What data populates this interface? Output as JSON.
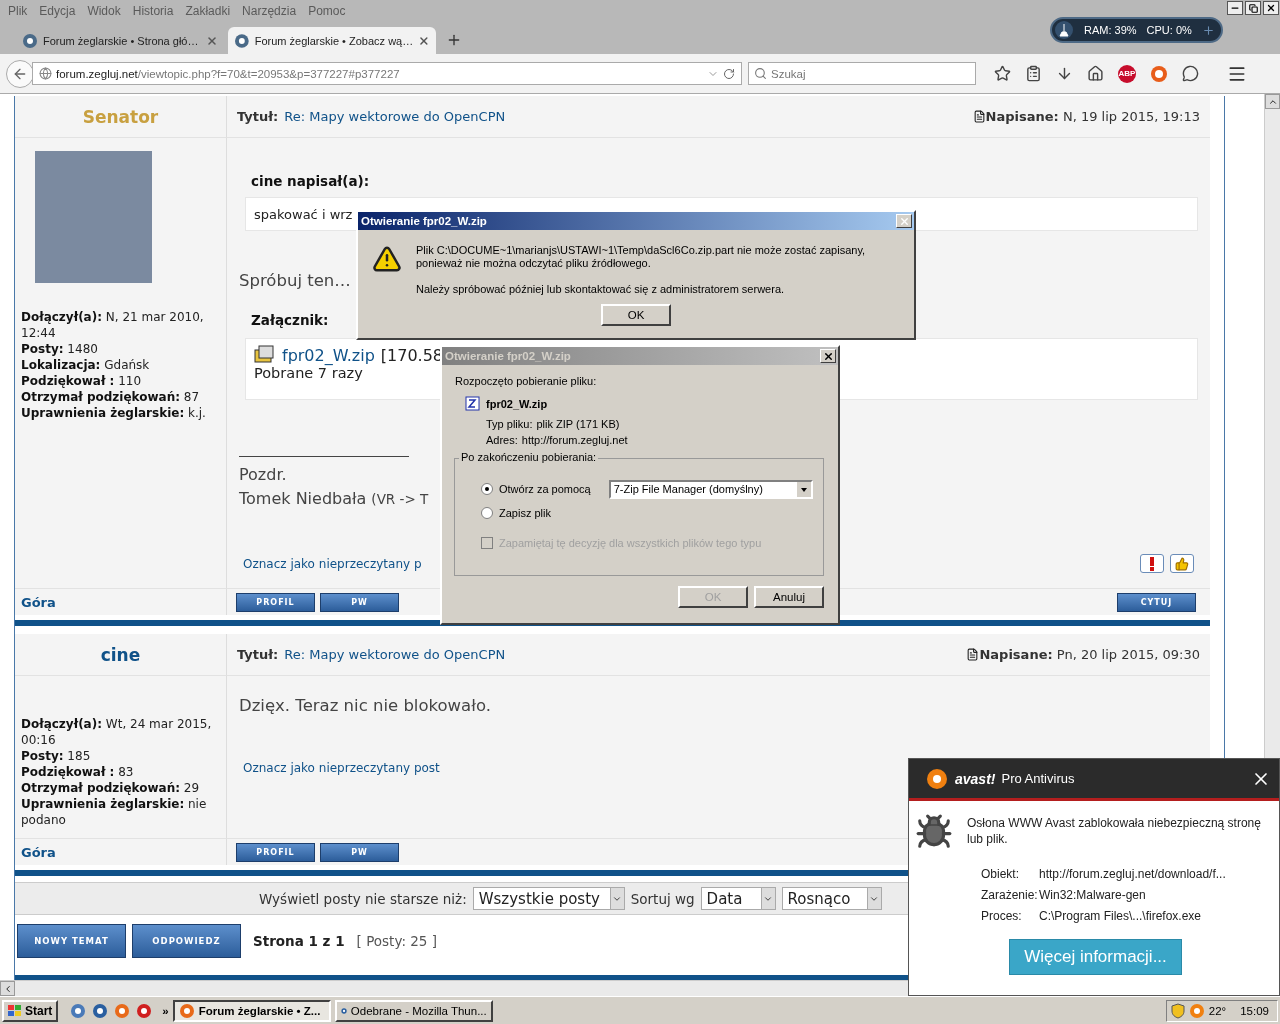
{
  "menu": [
    "Plik",
    "Edycja",
    "Widok",
    "Historia",
    "Zakładki",
    "Narzędzia",
    "Pomoc"
  ],
  "tabs": [
    {
      "label": "Forum żeglarskie • Strona głó…",
      "selected": false
    },
    {
      "label": "Forum żeglarskie • Zobacz wą…",
      "selected": true
    }
  ],
  "monitor": {
    "ram": "RAM: 39%",
    "cpu": "CPU: 0%"
  },
  "address": {
    "host": "forum.zegluj.net",
    "path": "/viewtopic.php?f=70&t=20953&p=377227#p377227"
  },
  "search": {
    "placeholder": "Szukaj"
  },
  "abp_badge": "ABP",
  "posts": [
    {
      "author": "Senator",
      "color": "#c8a040",
      "avatar": true,
      "title_label": "Tytuł:",
      "title": "Re: Mapy wektorowe do OpenCPN",
      "posted": "**Napisane:** N, 19 lip 2015, 19:13",
      "profile": [
        "**Dołączył(a):** N, 21 mar 2010, 12:44",
        "**Posty:** 1480",
        "**Lokalizacja:** Gdańsk",
        "**Podziękował :** 110",
        "**Otrzymał podziękowań:** 87",
        "**Uprawnienia żeglarskie:** k.j."
      ],
      "quote_author": "cine napisał(a):",
      "quote": "spakować i wrz",
      "text": "Spróbuj ten…",
      "attachment_label": "Załącznik:",
      "attachment": {
        "name": "fpr02_W.zip",
        "size": "[170.58",
        "downloads": "Pobrane 7 razy"
      },
      "signature": {
        "greeting": "Pozdr.",
        "name": "Tomek Niedbała",
        "note": "(VR -> T"
      },
      "mark_unread": "Oznacz jako nieprzeczytany p",
      "report_icons": true,
      "top": "Góra",
      "buttons": [
        "PROFIL",
        "PW"
      ],
      "quote_button": "CYTUJ"
    },
    {
      "author": "cine",
      "color": "#105289",
      "title_label": "Tytuł:",
      "title": "Re: Mapy wektorowe do OpenCPN",
      "posted": "**Napisane:** Pn, 20 lip 2015, 09:30",
      "profile": [
        "**Dołączył(a):** Wt, 24 mar 2015, 00:16",
        "**Posty:** 185",
        "**Podziękował :** 83",
        "**Otrzymał podziękowań:** 29",
        "**Uprawnienia żeglarskie:** nie podano"
      ],
      "text": "Dzięx. Teraz nic nie blokowało.",
      "mark_unread": "Oznacz jako nieprzeczytany post",
      "top": "Góra",
      "buttons": [
        "PROFIL",
        "PW"
      ]
    }
  ],
  "sort_bar": {
    "label": "Wyświetl posty nie starsze niż:",
    "range": "Wszystkie posty",
    "sort_label": "Sortuj wg",
    "sort_key": "Data",
    "order": "Rosnąco"
  },
  "actions": {
    "buttons": [
      "NOWY TEMAT",
      "ODPOWIEDZ"
    ],
    "page": "Strona 1 z 1",
    "count": "[ Posty: 25 ]"
  },
  "dialogs": [
    {
      "kind": "error",
      "active": true,
      "title": "Otwieranie fpr02_W.zip",
      "message": "Plik C:\\DOCUME~1\\marianjs\\USTAWI~1\\Temp\\daScl6Co.zip.part nie może zostać zapisany, ponieważ nie można odczytać pliku źródłowego.",
      "hint": "Należy spróbować później lub skontaktować się z administratorem serwera.",
      "ok": "OK"
    },
    {
      "kind": "download",
      "active": false,
      "title": "Otwieranie fpr02_W.zip",
      "heading": "Rozpoczęto pobieranie pliku:",
      "file": "fpr02_W.zip",
      "type_label": "Typ pliku:",
      "type": "plik ZIP (171 KB)",
      "address_label": "Adres:",
      "address": "http://forum.zegluj.net",
      "group": "Po zakończeniu pobierania:",
      "options": [
        {
          "label": "Otwórz za pomocą",
          "selected": true
        },
        {
          "label": "Zapisz plik",
          "selected": false
        }
      ],
      "app": "7-Zip File Manager (domyślny)",
      "remember": {
        "label": "Zapamiętaj tę decyzję dla wszystkich plików tego typu",
        "checked": false,
        "disabled": true
      },
      "buttons": [
        {
          "label": "OK",
          "disabled": true
        },
        {
          "label": "Anuluj",
          "disabled": false
        }
      ]
    }
  ],
  "avast": {
    "brand": "avast!",
    "product": "Pro Antivirus",
    "message": "Osłona WWW Avast zablokowała niebezpieczną stronę lub plik.",
    "details": [
      {
        "label": "Obiekt:",
        "value": "http://forum.zegluj.net/download/f..."
      },
      {
        "label": "Zarażenie:",
        "value": "Win32:Malware-gen"
      },
      {
        "label": "Proces:",
        "value": "C:\\Program Files\\...\\firefox.exe"
      }
    ],
    "button": "Więcej informacji..."
  },
  "taskbar": {
    "start": "Start",
    "chevron": "»",
    "tasks": [
      {
        "label": "Forum żeglarskie • Z...",
        "selected": true
      },
      {
        "label": "Odebrane - Mozilla Thun...",
        "selected": false
      }
    ],
    "temperature": "22°",
    "time": "15:09"
  }
}
